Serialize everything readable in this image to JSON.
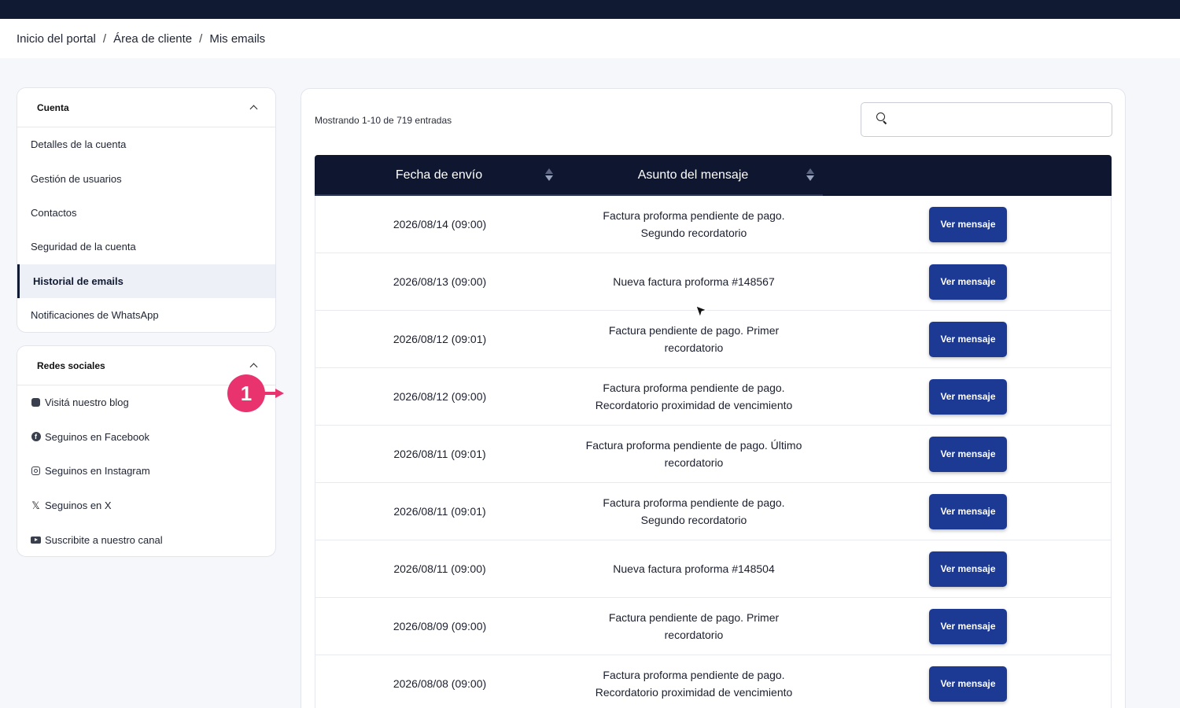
{
  "breadcrumb": {
    "items": [
      "Inicio del portal",
      "Área de cliente",
      "Mis emails"
    ],
    "separator": "/"
  },
  "sidebar": {
    "account": {
      "title": "Cuenta",
      "items": [
        {
          "label": "Detalles de la cuenta"
        },
        {
          "label": "Gestión de usuarios"
        },
        {
          "label": "Contactos"
        },
        {
          "label": "Seguridad de la cuenta"
        },
        {
          "label": "Historial de emails",
          "active": true
        },
        {
          "label": "Notificaciones de WhatsApp"
        }
      ]
    },
    "social": {
      "title": "Redes sociales",
      "items": [
        {
          "label": "Visitá nuestro blog",
          "icon": "blog-icon"
        },
        {
          "label": "Seguinos en Facebook",
          "icon": "facebook-icon"
        },
        {
          "label": "Seguinos en Instagram",
          "icon": "instagram-icon"
        },
        {
          "label": "Seguinos en X",
          "icon": "x-icon"
        },
        {
          "label": "Suscribite a nuestro canal",
          "icon": "youtube-icon"
        }
      ]
    }
  },
  "annotation": {
    "step": "1",
    "color": "#e8336f"
  },
  "main": {
    "entries_info": "Mostrando 1-10 de 719 entradas",
    "search": {
      "value": "",
      "placeholder": ""
    },
    "table": {
      "columns": [
        "Fecha de envío",
        "Asunto del mensaje",
        ""
      ],
      "button_label": "Ver mensaje",
      "rows": [
        {
          "date": "2026/08/14 (09:00)",
          "subject": [
            "Factura proforma pendiente de pago.",
            "Segundo recordatorio"
          ]
        },
        {
          "date": "2026/08/13 (09:00)",
          "subject": [
            "Nueva factura proforma #148567"
          ]
        },
        {
          "date": "2026/08/12 (09:01)",
          "subject": [
            "Factura pendiente de pago. Primer",
            "recordatorio"
          ]
        },
        {
          "date": "2026/08/12 (09:00)",
          "subject": [
            "Factura proforma pendiente de pago.",
            "Recordatorio proximidad de vencimiento"
          ]
        },
        {
          "date": "2026/08/11 (09:01)",
          "subject": [
            "Factura proforma pendiente de pago. Último",
            "recordatorio"
          ]
        },
        {
          "date": "2026/08/11 (09:01)",
          "subject": [
            "Factura proforma pendiente de pago.",
            "Segundo recordatorio"
          ]
        },
        {
          "date": "2026/08/11 (09:00)",
          "subject": [
            "Nueva factura proforma #148504"
          ]
        },
        {
          "date": "2026/08/09 (09:00)",
          "subject": [
            "Factura pendiente de pago. Primer",
            "recordatorio"
          ]
        },
        {
          "date": "2026/08/08 (09:00)",
          "subject": [
            "Factura proforma pendiente de pago.",
            "Recordatorio proximidad de vencimiento"
          ]
        }
      ]
    }
  },
  "colors": {
    "header_dark": "#0f1730",
    "button": "#1c3a94",
    "annotation": "#e8336f"
  }
}
